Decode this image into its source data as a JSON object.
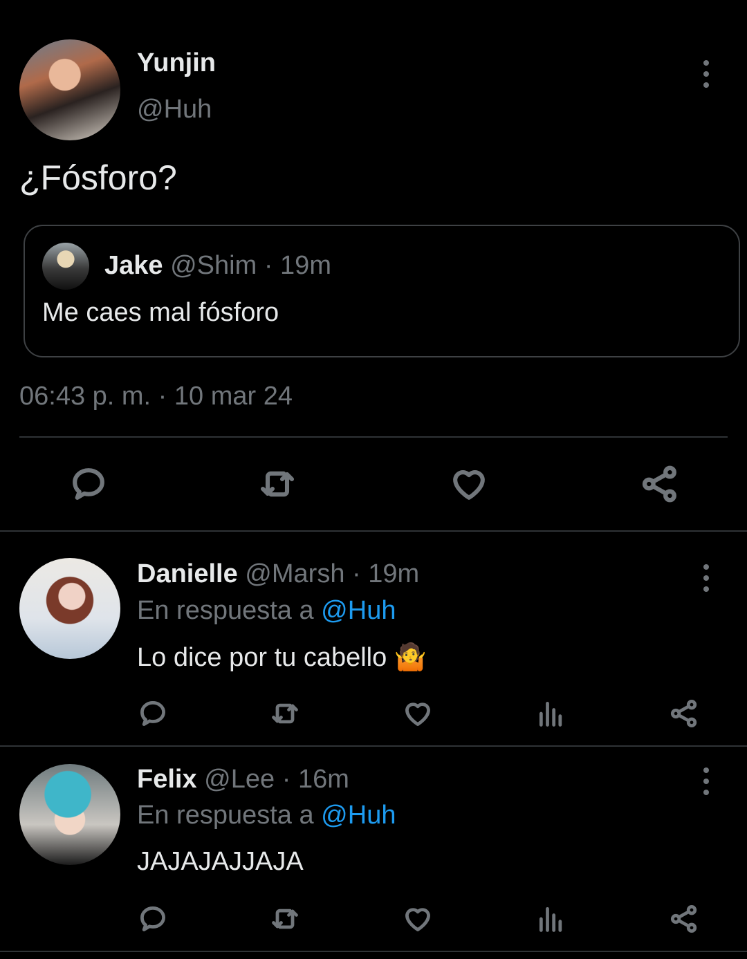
{
  "main_tweet": {
    "name": "Yunjin",
    "handle": "@Huh",
    "text": "¿Fósforo?",
    "quote": {
      "name": "Jake",
      "handle": "@Shim",
      "separator": "·",
      "time": "19m",
      "text": "Me caes mal fósforo"
    },
    "timestamp": "06:43 p. m. · 10 mar 24",
    "actions": [
      "reply-icon",
      "retweet-icon",
      "like-icon",
      "share-icon"
    ]
  },
  "replies": [
    {
      "name": "Danielle",
      "handle": "@Marsh",
      "separator": "·",
      "time": "19m",
      "reply_prefix": "En respuesta a",
      "reply_mention": "@Huh",
      "text": "Lo dice por tu cabello 🤷"
    },
    {
      "name": "Felix",
      "handle": "@Lee",
      "separator": "·",
      "time": "16m",
      "reply_prefix": "En respuesta a",
      "reply_mention": "@Huh",
      "text": "JAJAJAJJAJA"
    }
  ],
  "colors": {
    "background": "#000000",
    "text_primary": "#e7e9ea",
    "text_secondary": "#71767b",
    "accent": "#1d9bf0",
    "border": "#2f3336"
  }
}
